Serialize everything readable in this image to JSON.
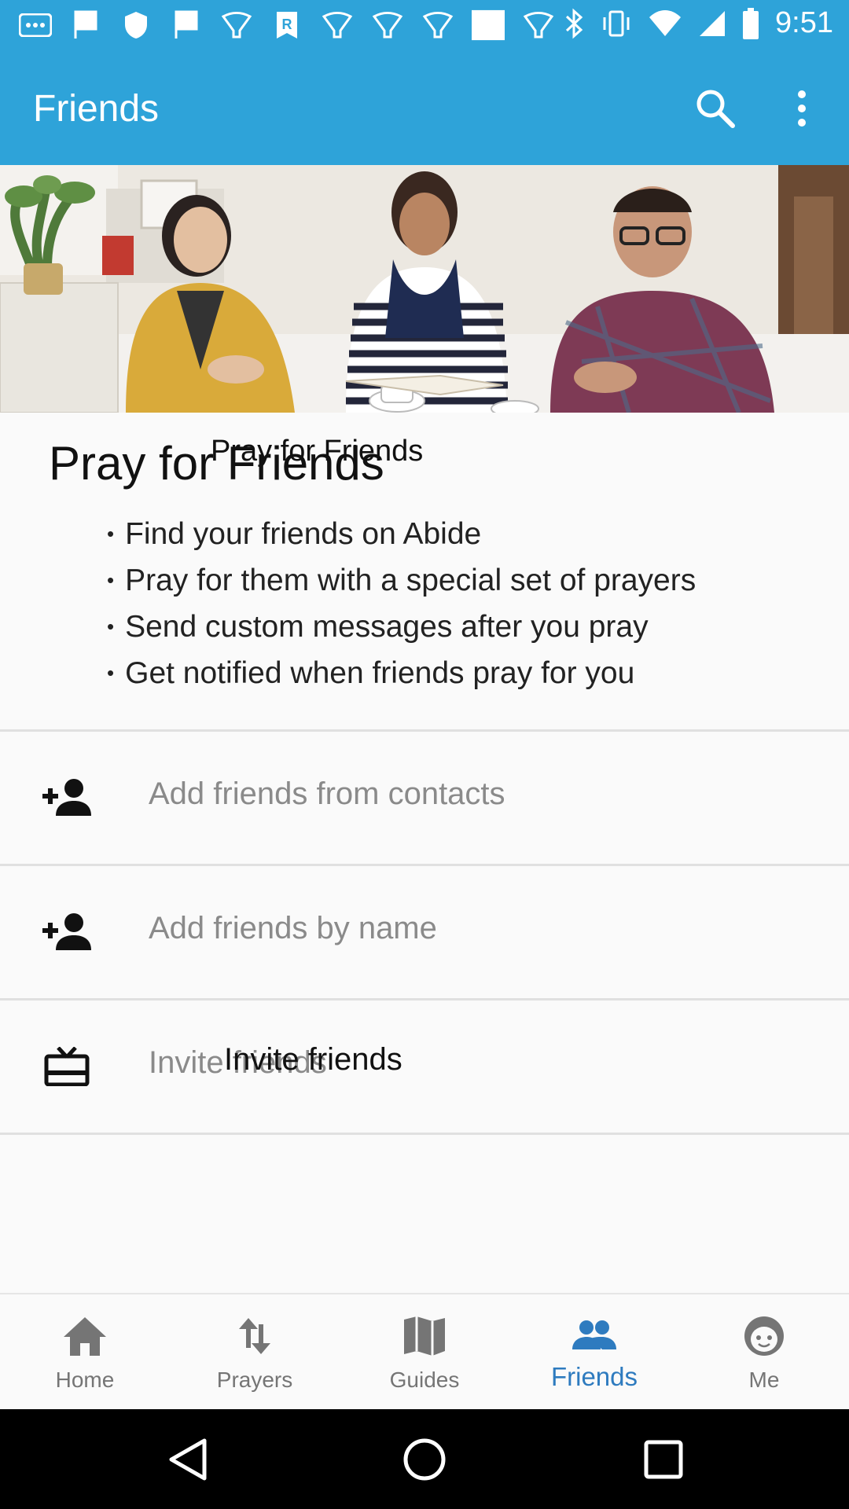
{
  "status_bar": {
    "time": "9:51",
    "notification_icons": [
      "app-icon",
      "flag-icon",
      "shield-icon",
      "flag-icon",
      "bulb-icon",
      "r-icon",
      "bulb-icon",
      "bulb-icon",
      "bulb-icon",
      "image-icon",
      "bulb-icon"
    ],
    "system_icons": [
      "bluetooth-icon",
      "vibrate-icon",
      "wifi-icon",
      "signal-icon",
      "battery-icon"
    ]
  },
  "app_bar": {
    "title": "Friends",
    "actions": [
      "search-icon",
      "more-vert-icon"
    ]
  },
  "hero": {
    "image_caption_overlay": "Pray for Friends"
  },
  "intro": {
    "title": "Pray for Friends",
    "bullets": [
      "Find your friends on Abide",
      "Pray for them with a special set of prayers",
      "Send custom messages after you pray",
      "Get notified when friends pray for you"
    ]
  },
  "actions": {
    "contacts": {
      "label": "Add friends from contacts",
      "icon": "person-add-icon"
    },
    "by_name": {
      "label": "Add friends by name",
      "icon": "person-add-icon"
    },
    "invite": {
      "label": "Invite friends",
      "label_overlay": "Invite friends",
      "icon": "gift-card-icon"
    }
  },
  "bottom_nav": {
    "items": [
      {
        "label": "Home",
        "icon": "home-icon"
      },
      {
        "label": "Prayers",
        "icon": "swap-vert-icon"
      },
      {
        "label": "Guides",
        "icon": "map-icon"
      },
      {
        "label": "Friends",
        "icon": "people-icon"
      },
      {
        "label": "Me",
        "icon": "face-icon"
      }
    ],
    "selected": "Friends"
  },
  "colors": {
    "primary": "#2ea3d9",
    "nav_active": "#2e7bbf",
    "nav_inactive": "#757575"
  }
}
